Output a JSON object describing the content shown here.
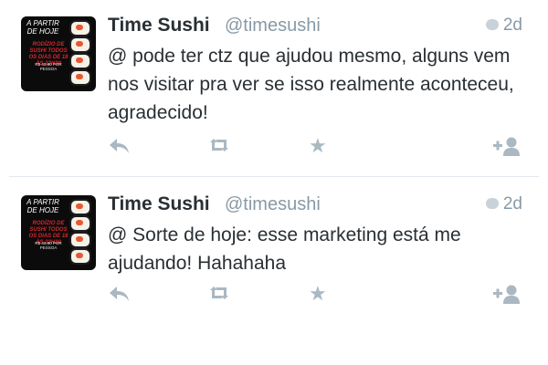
{
  "tweets": [
    {
      "name": "Time Sushi",
      "handle": "@timesushi",
      "age": "2d",
      "text": "@                     pode ter ctz que ajudou mesmo, alguns vem nos visitar pra ver se isso realmente aconteceu, agradecido!",
      "avatar": {
        "top": "A PARTIR DE HOJE",
        "red": "RODÍZIO DE SUSHI TODOS OS DIAS DE 18 ÀS 22H30",
        "white": "R$ 40,90 POR PESSOA"
      }
    },
    {
      "name": "Time Sushi",
      "handle": "@timesushi",
      "age": "2d",
      "text": "@                     Sorte de hoje: esse marketing está me ajudando! Hahahaha",
      "avatar": {
        "top": "A PARTIR DE HOJE",
        "red": "RODÍZIO DE SUSHI TODOS OS DIAS DE 18 ÀS 22H30",
        "white": "R$ 40,90 POR PESSOA"
      }
    }
  ],
  "icons": {
    "reply": "reply-icon",
    "retweet": "retweet-icon",
    "favorite": "star-icon",
    "follow": "follow-icon",
    "conversation": "speech-bubble-icon"
  },
  "colors": {
    "muted": "#8899a6",
    "icon": "#aab8c2",
    "text": "#292f33",
    "brand_red": "#d7262e"
  }
}
